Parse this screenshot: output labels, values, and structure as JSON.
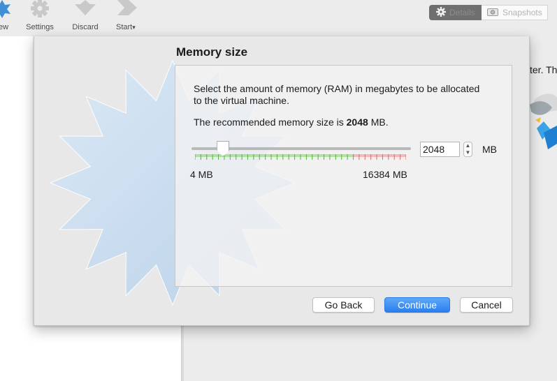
{
  "toolbar": {
    "new_label": "ew",
    "settings_label": "Settings",
    "discard_label": "Discard",
    "start_label": "Start",
    "start_menu_glyph": "▾",
    "new_icon": "new-star-icon",
    "settings_icon": "gear-icon",
    "discard_icon": "down-arrow-icon",
    "start_icon": "right-arrow-icon"
  },
  "view_toggle": {
    "details_label": "Details",
    "snapshots_label": "Snapshots",
    "details_icon": "gear-icon",
    "snapshots_icon": "camera-icon",
    "active": "Details"
  },
  "background": {
    "right_pane_text": "ter. Th"
  },
  "dialog": {
    "title": "Memory size",
    "description": "Select the amount of memory (RAM) in megabytes to be allocated to the virtual machine.",
    "recommended_prefix": "The recommended memory size is",
    "recommended_value": "2048",
    "recommended_suffix": "MB.",
    "slider": {
      "min_label": "4 MB",
      "max_label": "16384 MB",
      "min": 4,
      "max": 16384,
      "value": 2048
    },
    "memory_value": "2048",
    "unit": "MB",
    "buttons": {
      "back": "Go Back",
      "continue": "Continue",
      "cancel": "Cancel"
    }
  },
  "colors": {
    "accent": "#2a7ff0",
    "tick_green": "#7ed35e",
    "tick_red": "#f08a8a",
    "watermark": "#c7dcf0"
  }
}
